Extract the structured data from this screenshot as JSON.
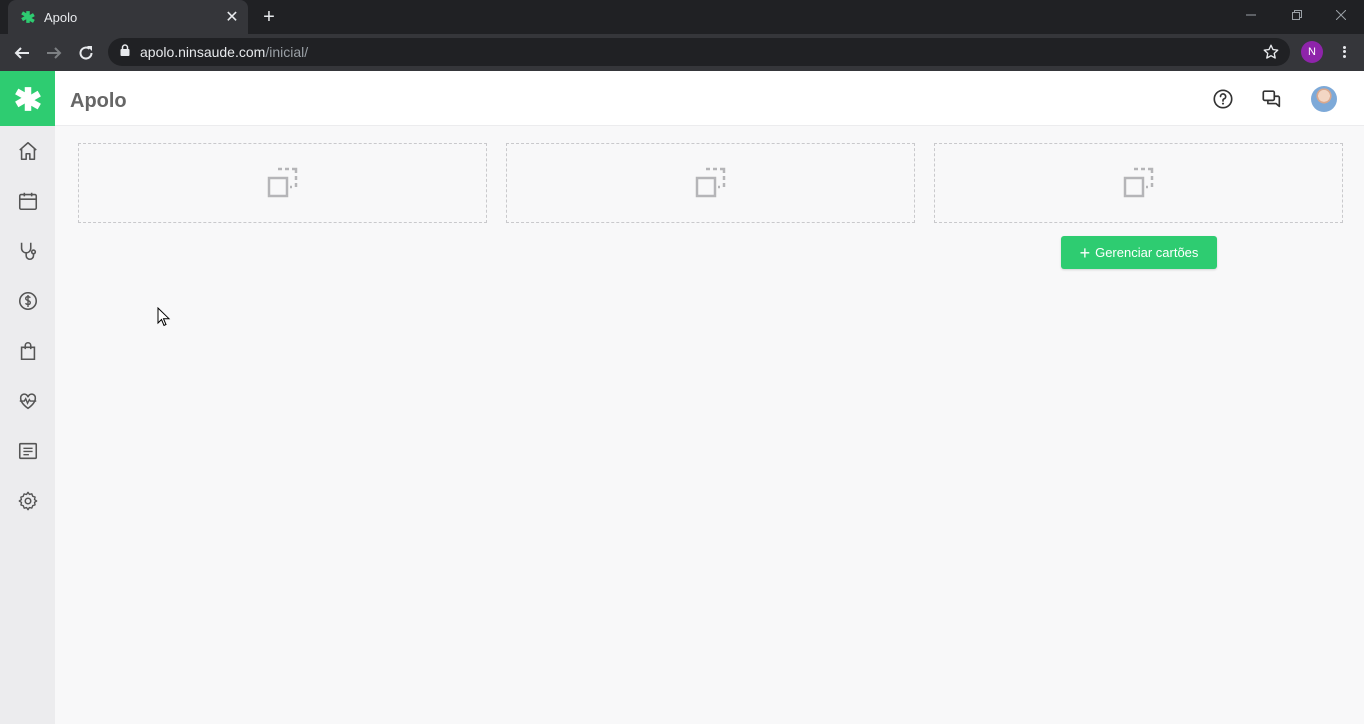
{
  "browser": {
    "tab_title": "Apolo",
    "url_host": "apolo.ninsaude.com",
    "url_path": "/inicial/",
    "profile_initial": "N",
    "icons": [
      "back-icon",
      "forward-icon",
      "reload-icon",
      "lock-icon",
      "star-icon",
      "menu-icon"
    ]
  },
  "app": {
    "title": "Apolo",
    "accent_color": "#2ecc71",
    "sidebar": {
      "items": [
        {
          "name": "home",
          "icon": "home-icon"
        },
        {
          "name": "calendar",
          "icon": "calendar-icon"
        },
        {
          "name": "stethoscope",
          "icon": "stethoscope-icon"
        },
        {
          "name": "financial",
          "icon": "dollar-icon"
        },
        {
          "name": "shopping",
          "icon": "bag-icon"
        },
        {
          "name": "health",
          "icon": "heart-pulse-icon"
        },
        {
          "name": "reports",
          "icon": "list-icon"
        },
        {
          "name": "settings",
          "icon": "gear-icon"
        }
      ]
    },
    "header_icons": [
      "help-icon",
      "chat-icon",
      "avatar"
    ],
    "cards": [
      {
        "icon": "card-placeholder-icon"
      },
      {
        "icon": "card-placeholder-icon"
      },
      {
        "icon": "card-placeholder-icon"
      }
    ],
    "manage_button_label": "Gerenciar cartões"
  }
}
